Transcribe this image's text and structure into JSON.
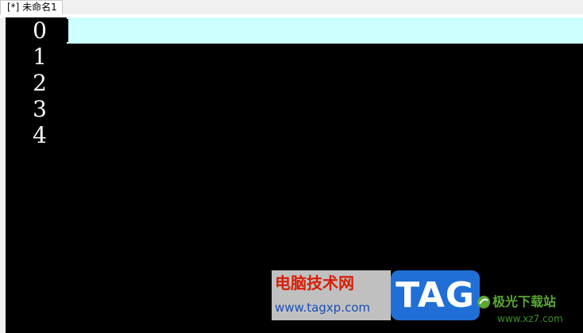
{
  "tabs": [
    {
      "label": "[*] 未命名1",
      "active": true
    }
  ],
  "editor": {
    "line_numbers": [
      "0",
      "1",
      "2",
      "3",
      "4"
    ],
    "current_line_index": 0,
    "lines": [
      "",
      "",
      "",
      "",
      ""
    ]
  },
  "colors": {
    "editor_background": "#000000",
    "line_number_color": "#ffffff",
    "current_line_highlight": "#ccffff",
    "tab_background": "#ffffff"
  },
  "watermark": {
    "title": "电脑技术网",
    "url": "www.tagxp.com",
    "badge": "TAG",
    "site_name": "极光下载站",
    "site_url": "www.xz7.com"
  }
}
